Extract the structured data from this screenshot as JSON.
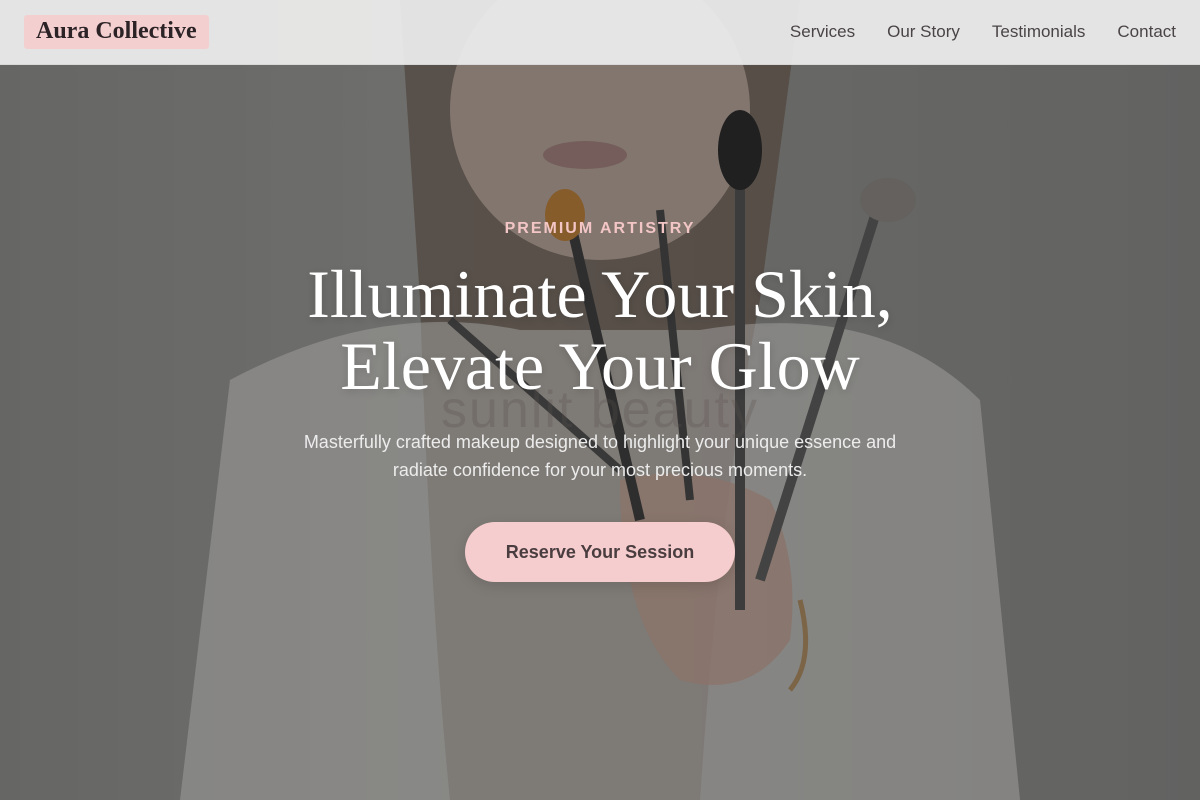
{
  "header": {
    "brand": "Aura Collective",
    "nav": [
      {
        "label": "Services"
      },
      {
        "label": "Our Story"
      },
      {
        "label": "Testimonials"
      },
      {
        "label": "Contact"
      }
    ]
  },
  "hero": {
    "eyebrow": "PREMIUM ARTISTRY",
    "headline_line1": "Illuminate Your Skin,",
    "headline_line2": "Elevate Your Glow",
    "ghost_text": "sunlit beauty",
    "subtitle": "Masterfully crafted makeup designed to highlight your unique essence and radiate confidence for your most precious moments.",
    "cta_label": "Reserve Your Session",
    "background_image": "woman-holding-makeup-brushes"
  },
  "colors": {
    "accent_pink": "#f6cdce",
    "eyebrow_pink": "#f3c6c6",
    "header_bg": "#eeeeee",
    "text_dark": "#2c2326"
  }
}
